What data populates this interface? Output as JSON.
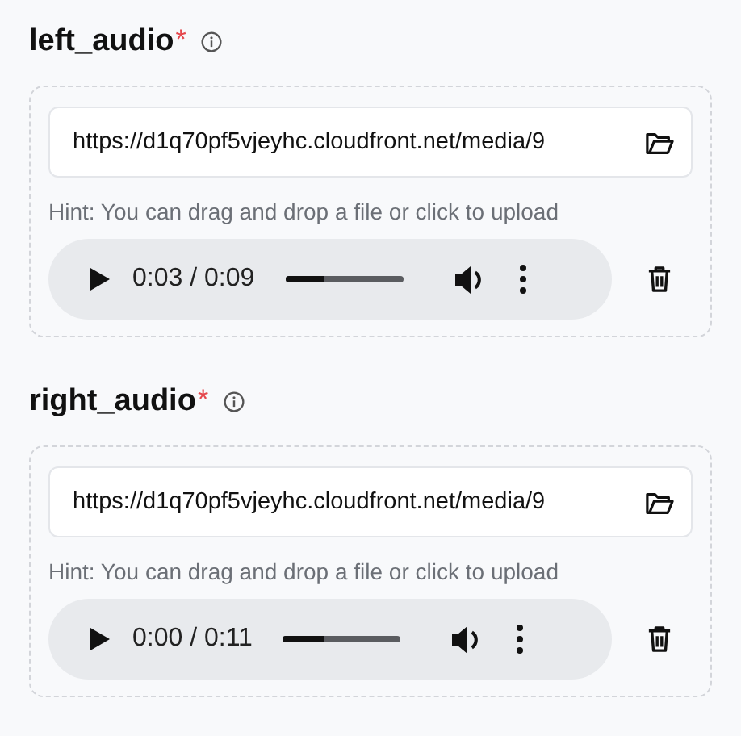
{
  "fields": [
    {
      "label": "left_audio",
      "required_mark": "*",
      "url": "https://d1q70pf5vjeyhc.cloudfront.net/media/9",
      "hint": "Hint: You can drag and drop a file or click to upload",
      "player": {
        "time": "0:03 / 0:09",
        "level": 0.34
      }
    },
    {
      "label": "right_audio",
      "required_mark": "*",
      "url": "https://d1q70pf5vjeyhc.cloudfront.net/media/9",
      "hint": "Hint: You can drag and drop a file or click to upload",
      "player": {
        "time": "0:00 / 0:11",
        "level": 0.35
      }
    }
  ]
}
